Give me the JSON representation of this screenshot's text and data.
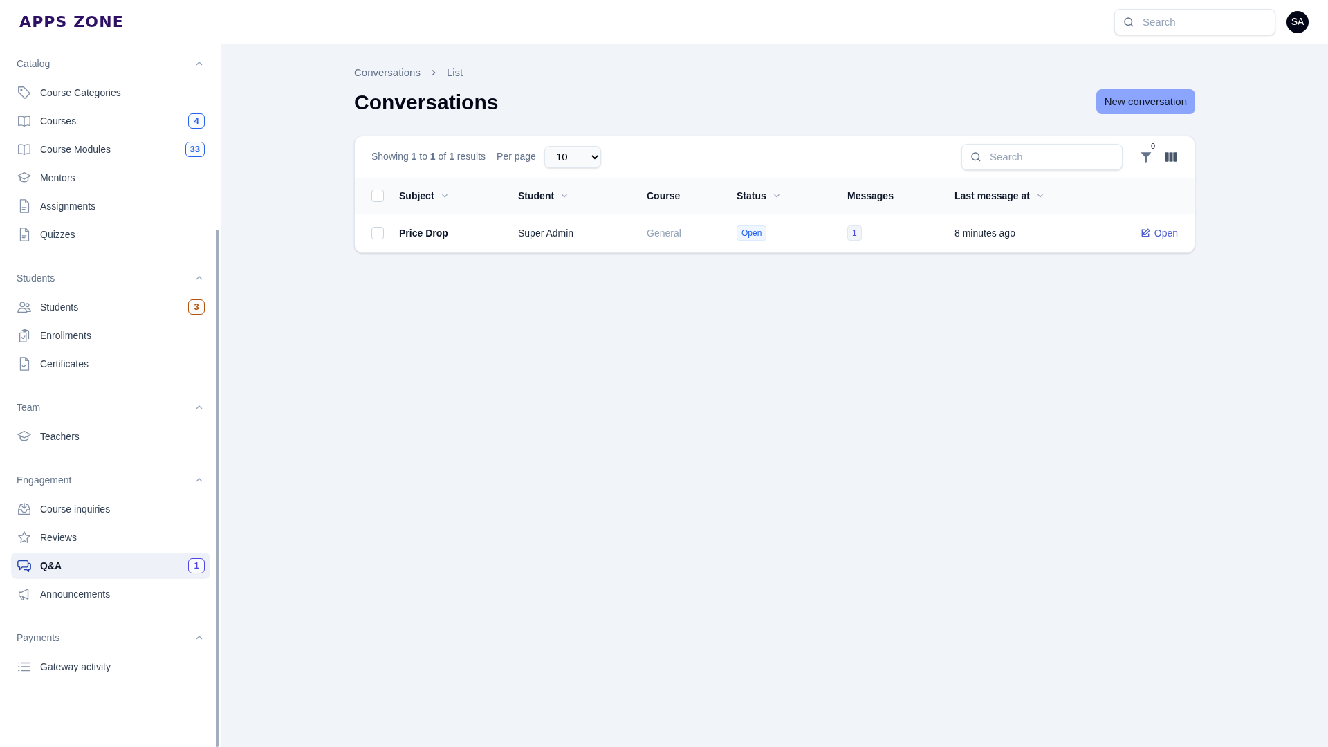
{
  "header": {
    "logo": "APPS ZONE",
    "search": {
      "placeholder": "Search"
    },
    "avatar": "SA"
  },
  "sidebar": {
    "groups": [
      {
        "label": "Catalog",
        "expanded": true,
        "items": [
          {
            "label": "Course Categories",
            "selected": false
          },
          {
            "label": "Courses",
            "selected": false,
            "badge": {
              "text": "4",
              "color": "#2563eb"
            }
          },
          {
            "label": "Course Modules",
            "selected": false,
            "badge": {
              "text": "33",
              "color": "#2563eb"
            }
          },
          {
            "label": "Mentors",
            "selected": false
          },
          {
            "label": "Assignments",
            "selected": false
          },
          {
            "label": "Quizzes",
            "selected": false
          }
        ]
      },
      {
        "label": "Students",
        "expanded": true,
        "items": [
          {
            "label": "Students",
            "selected": false,
            "badge": {
              "text": "3",
              "color": "#b45309"
            }
          },
          {
            "label": "Enrollments",
            "selected": false
          },
          {
            "label": "Certificates",
            "selected": false
          }
        ]
      },
      {
        "label": "Team",
        "expanded": true,
        "items": [
          {
            "label": "Teachers",
            "selected": false
          }
        ]
      },
      {
        "label": "Engagement",
        "expanded": true,
        "items": [
          {
            "label": "Course inquiries",
            "selected": false
          },
          {
            "label": "Reviews",
            "selected": false
          },
          {
            "label": "Q&A",
            "selected": true,
            "badge": {
              "text": "1",
              "color": "#4f46e5"
            }
          },
          {
            "label": "Announcements",
            "selected": false
          }
        ]
      },
      {
        "label": "Payments",
        "expanded": true,
        "items": [
          {
            "label": "Gateway activity",
            "selected": false
          }
        ]
      }
    ]
  },
  "breadcrumb": [
    "Conversations",
    "List"
  ],
  "title": "Conversations",
  "new_button": "New conversation",
  "table": {
    "summary": "Showing **1** to **1** of **1** results",
    "per_page_label": "Per page",
    "per_page": "10",
    "search": {
      "placeholder": "Search"
    },
    "filter_count": "0",
    "select_all": {
      "checked": false
    },
    "columns": [
      {
        "label": "Subject",
        "sortable": true
      },
      {
        "label": "Student",
        "sortable": true
      },
      {
        "label": "Course",
        "sortable": false
      },
      {
        "label": "Status",
        "sortable": true
      },
      {
        "label": "Messages",
        "sortable": false
      },
      {
        "label": "Last message at",
        "sortable": true
      }
    ],
    "rows": [
      {
        "checked": false,
        "subject": "Price Drop",
        "student": "Super Admin",
        "course": "General",
        "status": "Open",
        "messages": "1",
        "last_message": "8 minutes ago",
        "action": "Open"
      }
    ]
  }
}
